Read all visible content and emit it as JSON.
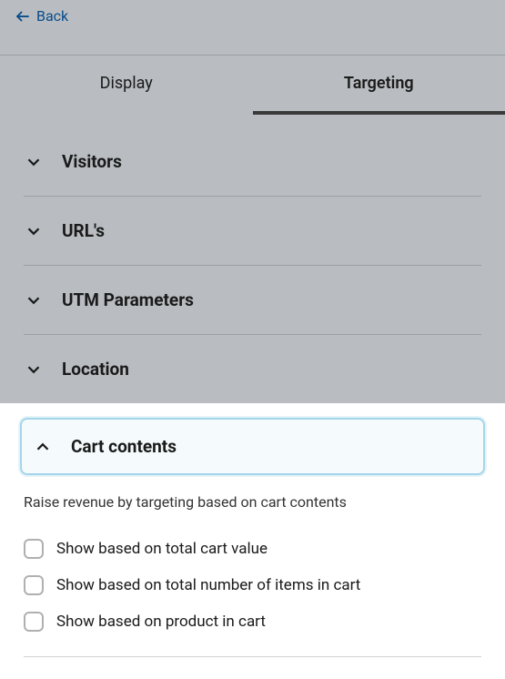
{
  "header": {
    "back_label": "Back"
  },
  "tabs": {
    "display": "Display",
    "targeting": "Targeting"
  },
  "accordion": {
    "visitors": "Visitors",
    "urls": "URL's",
    "utm": "UTM Parameters",
    "location": "Location",
    "cart": "Cart contents"
  },
  "cart_panel": {
    "description": "Raise revenue by targeting based on cart contents",
    "options": {
      "total_value": "Show based on total cart value",
      "total_items": "Show based on total number of items in cart",
      "product": "Show based on product in cart"
    }
  }
}
